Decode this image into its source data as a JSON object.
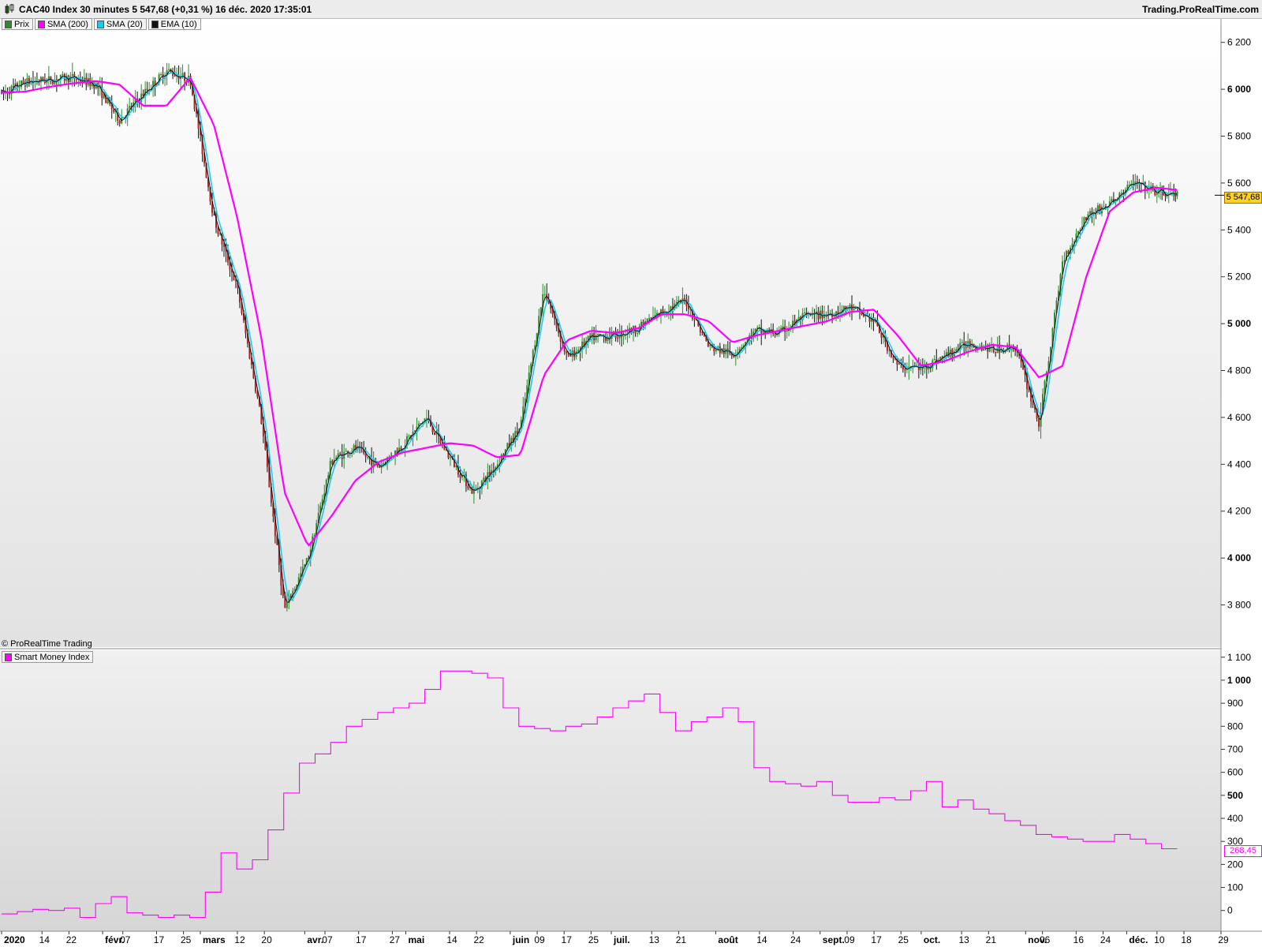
{
  "header": {
    "title": "CAC40 Index 30 minutes 5 547,68 (+0,31 %) 16 déc. 2020 17:35:01",
    "brand": "Trading.ProRealTime.com"
  },
  "legend": [
    {
      "label": "Prix",
      "color": "#2e8b2e"
    },
    {
      "label": "SMA (200)",
      "color": "#ff00ff"
    },
    {
      "label": "SMA (20)",
      "color": "#1ec8f0"
    },
    {
      "label": "EMA (10)",
      "color": "#111111"
    }
  ],
  "copyright": "© ProRealTime Trading",
  "indicator_legend": {
    "label": "Smart Money Index",
    "color": "#ff00ff"
  },
  "price_tag": "5 547,68",
  "smi_tag": "268,45",
  "chart_data": [
    {
      "type": "line",
      "name": "CAC40 30 minutes",
      "ylim": [
        3620,
        6300
      ],
      "ytick_labels": [
        {
          "v": 3800,
          "label": "3 800",
          "bold": false
        },
        {
          "v": 4000,
          "label": "4 000",
          "bold": true
        },
        {
          "v": 4200,
          "label": "4 200",
          "bold": false
        },
        {
          "v": 4400,
          "label": "4 400",
          "bold": false
        },
        {
          "v": 4600,
          "label": "4 600",
          "bold": false
        },
        {
          "v": 4800,
          "label": "4 800",
          "bold": false
        },
        {
          "v": 5000,
          "label": "5 000",
          "bold": true
        },
        {
          "v": 5200,
          "label": "5 200",
          "bold": false
        },
        {
          "v": 5400,
          "label": "5 400",
          "bold": false
        },
        {
          "v": 5600,
          "label": "5 600",
          "bold": false
        },
        {
          "v": 5800,
          "label": "5 800",
          "bold": false
        },
        {
          "v": 6000,
          "label": "6 000",
          "bold": true
        },
        {
          "v": 6200,
          "label": "6 200",
          "bold": false
        }
      ],
      "x_dates": [
        "2020-01-02",
        "2020-01-09",
        "2020-01-16",
        "2020-01-23",
        "2020-01-30",
        "2020-02-06",
        "2020-02-13",
        "2020-02-20",
        "2020-02-27",
        "2020-03-05",
        "2020-03-12",
        "2020-03-19",
        "2020-03-26",
        "2020-04-02",
        "2020-04-09",
        "2020-04-16",
        "2020-04-23",
        "2020-04-30",
        "2020-05-07",
        "2020-05-14",
        "2020-05-21",
        "2020-05-28",
        "2020-06-04",
        "2020-06-11",
        "2020-06-18",
        "2020-06-25",
        "2020-07-02",
        "2020-07-09",
        "2020-07-16",
        "2020-07-23",
        "2020-07-30",
        "2020-08-06",
        "2020-08-13",
        "2020-08-20",
        "2020-08-27",
        "2020-09-03",
        "2020-09-10",
        "2020-09-17",
        "2020-09-24",
        "2020-10-01",
        "2020-10-08",
        "2020-10-15",
        "2020-10-22",
        "2020-10-29",
        "2020-11-05",
        "2020-11-12",
        "2020-11-19",
        "2020-11-26",
        "2020-12-03",
        "2020-12-10",
        "2020-12-16"
      ],
      "series": [
        {
          "name": "Prix",
          "color": "#2e8b2e",
          "values": [
            5980,
            6030,
            6040,
            6050,
            6020,
            5870,
            5980,
            6080,
            6040,
            5450,
            5150,
            4600,
            3780,
            4000,
            4420,
            4470,
            4390,
            4480,
            4600,
            4430,
            4280,
            4400,
            4560,
            5150,
            4850,
            4940,
            4950,
            4980,
            5050,
            5100,
            4900,
            4870,
            4970,
            4960,
            5030,
            5040,
            5070,
            5010,
            4820,
            4810,
            4860,
            4920,
            4890,
            4900,
            4570,
            5270,
            5460,
            5510,
            5600,
            5560,
            5548
          ]
        },
        {
          "name": "SMA (200)",
          "color": "#ff00ff",
          "values": [
            5985,
            5990,
            6010,
            6025,
            6035,
            6020,
            5930,
            5930,
            6050,
            5850,
            5450,
            4950,
            4280,
            4050,
            4180,
            4330,
            4410,
            4450,
            4470,
            4490,
            4480,
            4430,
            4440,
            4780,
            4930,
            4970,
            4960,
            4980,
            5040,
            5040,
            5010,
            4920,
            4950,
            4970,
            4990,
            5010,
            5050,
            5060,
            4950,
            4820,
            4840,
            4880,
            4910,
            4900,
            4770,
            4820,
            5200,
            5480,
            5560,
            5580,
            5570
          ]
        }
      ]
    },
    {
      "type": "line",
      "name": "Smart Money Index",
      "ylim": [
        -90,
        1130
      ],
      "ytick_labels": [
        {
          "v": 0,
          "label": "0",
          "bold": false
        },
        {
          "v": 100,
          "label": "100",
          "bold": false
        },
        {
          "v": 200,
          "label": "200",
          "bold": false
        },
        {
          "v": 300,
          "label": "300",
          "bold": false
        },
        {
          "v": 400,
          "label": "400",
          "bold": false
        },
        {
          "v": 500,
          "label": "500",
          "bold": true
        },
        {
          "v": 600,
          "label": "600",
          "bold": false
        },
        {
          "v": 700,
          "label": "700",
          "bold": false
        },
        {
          "v": 800,
          "label": "800",
          "bold": false
        },
        {
          "v": 900,
          "label": "900",
          "bold": false
        },
        {
          "v": 1000,
          "label": "1 000",
          "bold": true
        },
        {
          "v": 1100,
          "label": "1 100",
          "bold": false
        }
      ],
      "series": [
        {
          "name": "Smart Money Index",
          "color": "#ff00ff",
          "values": [
            -15,
            -5,
            5,
            0,
            10,
            -30,
            30,
            60,
            -10,
            -20,
            -30,
            -20,
            -30,
            80,
            250,
            180,
            220,
            350,
            510,
            640,
            680,
            730,
            800,
            830,
            860,
            880,
            900,
            960,
            1040,
            1040,
            1030,
            1010,
            880,
            800,
            790,
            780,
            800,
            810,
            840,
            880,
            910,
            940,
            860,
            780,
            820,
            840,
            880,
            820,
            620,
            560,
            550,
            540,
            560,
            500,
            470,
            470,
            490,
            480,
            520,
            560,
            450,
            480,
            440,
            420,
            390,
            370,
            330,
            320,
            310,
            300,
            300,
            330,
            310,
            290,
            268
          ]
        }
      ]
    }
  ],
  "x_axis": {
    "start": "2020-01-02",
    "end": "2020-12-29",
    "labels": [
      {
        "d": "2020-01-02",
        "label": "2020",
        "bold": true
      },
      {
        "d": "2020-01-14",
        "label": "14",
        "bold": false
      },
      {
        "d": "2020-01-22",
        "label": "22",
        "bold": false
      },
      {
        "d": "2020-02-01",
        "label": "févr.",
        "bold": true
      },
      {
        "d": "2020-02-07",
        "label": "07",
        "bold": false
      },
      {
        "d": "2020-02-17",
        "label": "17",
        "bold": false
      },
      {
        "d": "2020-02-25",
        "label": "25",
        "bold": false
      },
      {
        "d": "2020-03-01",
        "label": "mars",
        "bold": true
      },
      {
        "d": "2020-03-12",
        "label": "12",
        "bold": false
      },
      {
        "d": "2020-03-20",
        "label": "20",
        "bold": false
      },
      {
        "d": "2020-04-01",
        "label": "avr.",
        "bold": true
      },
      {
        "d": "2020-04-07",
        "label": "07",
        "bold": false
      },
      {
        "d": "2020-04-17",
        "label": "17",
        "bold": false
      },
      {
        "d": "2020-04-27",
        "label": "27",
        "bold": false
      },
      {
        "d": "2020-05-01",
        "label": "mai",
        "bold": true
      },
      {
        "d": "2020-05-14",
        "label": "14",
        "bold": false
      },
      {
        "d": "2020-05-22",
        "label": "22",
        "bold": false
      },
      {
        "d": "2020-06-01",
        "label": "juin",
        "bold": true
      },
      {
        "d": "2020-06-09",
        "label": "09",
        "bold": false
      },
      {
        "d": "2020-06-17",
        "label": "17",
        "bold": false
      },
      {
        "d": "2020-06-25",
        "label": "25",
        "bold": false
      },
      {
        "d": "2020-07-01",
        "label": "juil.",
        "bold": true
      },
      {
        "d": "2020-07-13",
        "label": "13",
        "bold": false
      },
      {
        "d": "2020-07-21",
        "label": "21",
        "bold": false
      },
      {
        "d": "2020-08-01",
        "label": "août",
        "bold": true
      },
      {
        "d": "2020-08-14",
        "label": "14",
        "bold": false
      },
      {
        "d": "2020-08-24",
        "label": "24",
        "bold": false
      },
      {
        "d": "2020-09-01",
        "label": "sept.",
        "bold": true
      },
      {
        "d": "2020-09-09",
        "label": "09",
        "bold": false
      },
      {
        "d": "2020-09-17",
        "label": "17",
        "bold": false
      },
      {
        "d": "2020-09-25",
        "label": "25",
        "bold": false
      },
      {
        "d": "2020-10-01",
        "label": "oct.",
        "bold": true
      },
      {
        "d": "2020-10-13",
        "label": "13",
        "bold": false
      },
      {
        "d": "2020-10-21",
        "label": "21",
        "bold": false
      },
      {
        "d": "2020-11-01",
        "label": "nov.",
        "bold": true
      },
      {
        "d": "2020-11-06",
        "label": "06",
        "bold": false
      },
      {
        "d": "2020-11-16",
        "label": "16",
        "bold": false
      },
      {
        "d": "2020-11-24",
        "label": "24",
        "bold": false
      },
      {
        "d": "2020-12-01",
        "label": "déc.",
        "bold": true
      },
      {
        "d": "2020-12-10",
        "label": "10",
        "bold": false
      },
      {
        "d": "2020-12-18",
        "label": "18",
        "bold": false
      },
      {
        "d": "2020-12-29",
        "label": "29",
        "bold": false
      }
    ]
  }
}
